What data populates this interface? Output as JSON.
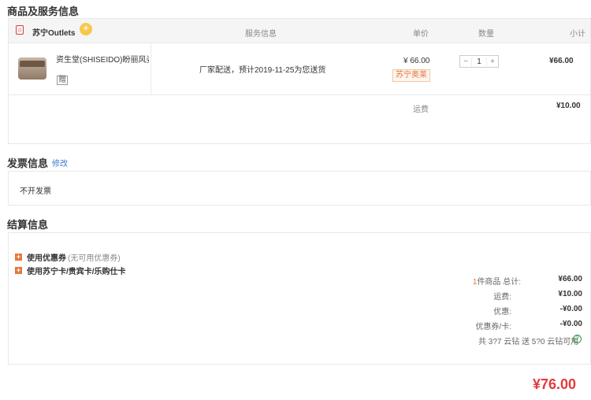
{
  "goods_section": {
    "title": "商品及服务信息",
    "store_name": "苏宁Outlets",
    "headers": {
      "service": "服务信息",
      "unit_price": "单价",
      "quantity": "数量",
      "subtotal": "小计"
    },
    "item": {
      "name": "资生堂(SHISEIDO)盼丽风姿…",
      "gift_icon_label": "赠",
      "service_text": "厂家配送，预计2019-11-25为您送货",
      "unit_price": "¥ 66.00",
      "promo_tag": "苏宁奥莱",
      "quantity": "1",
      "minus": "−",
      "plus": "+",
      "subtotal": "¥66.00"
    },
    "shipping_label": "运费",
    "shipping_value": "¥10.00"
  },
  "invoice_section": {
    "title": "发票信息",
    "edit_label": "修改",
    "invoice_value": "不开发票"
  },
  "checkout_section": {
    "title": "结算信息",
    "coupon_label": "使用优惠券",
    "coupon_note": "(无可用优惠券)",
    "card_label": "使用苏宁卡/贵宾卡/乐购仕卡",
    "summary": {
      "count": "1",
      "goods_label": "件商品 总计:",
      "goods_value": "¥66.00",
      "shipping_label": "运费:",
      "shipping_value": "¥10.00",
      "discount_label": "优惠:",
      "discount_value": "-¥0.00",
      "coupon_card_label": "优惠券/卡:",
      "coupon_card_value": "-¥0.00",
      "points_text": "共 3?7 云钻 送 5?0 云钻可用",
      "total_value": "¥76.00"
    }
  },
  "colors": {
    "accent": "#e4783b",
    "red": "#e4393c",
    "link": "#3a7bd5"
  }
}
